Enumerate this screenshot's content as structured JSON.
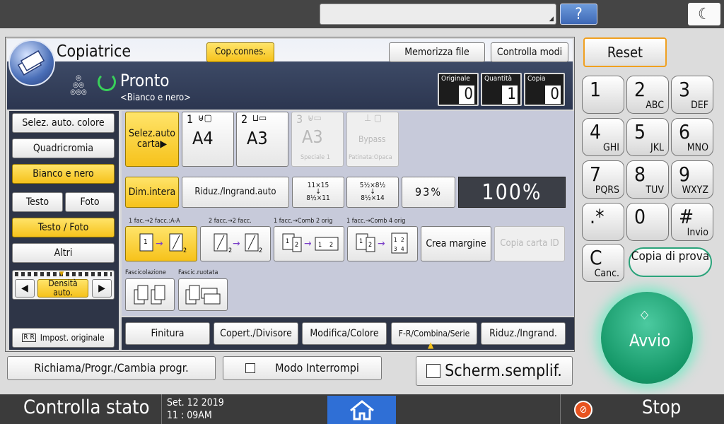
{
  "top": {
    "help_label": "?"
  },
  "header": {
    "title": "Copiatrice",
    "conn_btn": "Cop.connes.",
    "store_btn": "Memorizza file",
    "check_btn": "Controlla modi",
    "status": "Pronto",
    "sub": "<Bianco e nero>"
  },
  "counters": [
    {
      "label": "Originale",
      "value": "0"
    },
    {
      "label": "Quantità",
      "value": "1"
    },
    {
      "label": "Copia",
      "value": "0"
    }
  ],
  "left": {
    "color_auto": "Selez. auto. colore",
    "fullcolor": "Quadricromia",
    "bw": "Bianco e nero",
    "text": "Testo",
    "photo": "Foto",
    "textphoto": "Testo / Foto",
    "others": "Altri",
    "density": "Densità auto.",
    "orig_settings": "Impost. originale"
  },
  "paper": {
    "auto": "Selez.auto carta▶",
    "t1_num": "1",
    "t1_size": "A4",
    "t2_num": "2",
    "t2_size": "A3",
    "t3_num": "3",
    "t3_size": "A3",
    "t3_sub": "Speciale 1",
    "bypass": "Bypass",
    "bypass_sub": "Patinata:Opaca"
  },
  "ratio": {
    "full": "Dim.intera",
    "auto": "Riduz./Ingrand.auto",
    "r1_top": "11×15",
    "r1_bot": "8½×11",
    "r2_top": "5½×8½",
    "r2_bot": "8½×14",
    "pct": "93%",
    "current": "100%"
  },
  "duplex": {
    "l1": "1 fac.→2 facc.:A-A",
    "l2": "2 facc.→2 facc.",
    "l3": "1 facc.→Comb 2 orig",
    "l4": "1 facc.→Comb 4 orig",
    "margin": "Crea margine",
    "idcopy": "Copia carta ID"
  },
  "sort": {
    "l1": "Fascicolazione",
    "l2": "Fascic.ruotata"
  },
  "tabs": [
    "Finitura",
    "Copert./Divisore",
    "Modifica/Colore",
    "F-R/Combina/Serie",
    "Riduz./Ingrand."
  ],
  "bottom": {
    "recall": "Richiama/Progr./Cambia progr.",
    "interrupt": "Modo Interrompi",
    "simple": "Scherm.semplif."
  },
  "keypad": {
    "reset": "Reset",
    "keys": [
      {
        "n": "1",
        "s": ""
      },
      {
        "n": "2",
        "s": "ABC"
      },
      {
        "n": "3",
        "s": "DEF"
      },
      {
        "n": "4",
        "s": "GHI"
      },
      {
        "n": "5",
        "s": "JKL"
      },
      {
        "n": "6",
        "s": "MNO"
      },
      {
        "n": "7",
        "s": "PQRS"
      },
      {
        "n": "8",
        "s": "TUV"
      },
      {
        "n": "9",
        "s": "WXYZ"
      },
      {
        "n": ".*",
        "s": ""
      },
      {
        "n": "0",
        "s": ""
      },
      {
        "n": "#",
        "s": "Invio"
      }
    ],
    "clear_n": "C",
    "clear_s": "Canc.",
    "proof": "Copia di prova",
    "start": "Avvio"
  },
  "statusbar": {
    "check": "Controlla stato",
    "date": "Set. 12 2019",
    "time": "11 : 09AM",
    "stop": "Stop"
  }
}
